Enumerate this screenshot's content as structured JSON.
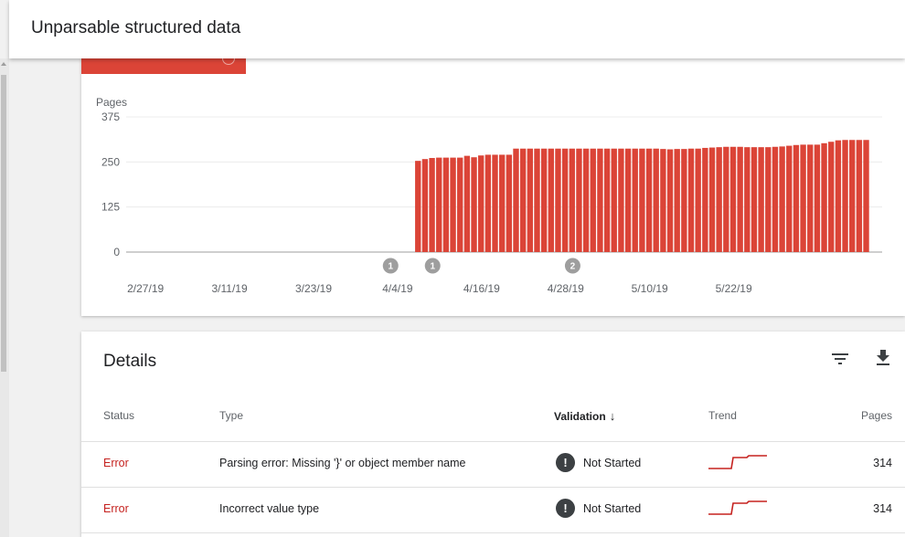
{
  "header": {
    "title": "Unparsable structured data"
  },
  "chart_data": {
    "type": "bar",
    "ylabel": "Pages",
    "ylim": [
      0,
      375
    ],
    "yticks": [
      "375",
      "250",
      "125",
      "0"
    ],
    "ytick_values": [
      375,
      250,
      125,
      0
    ],
    "xticks": [
      "2/27/19",
      "3/11/19",
      "3/23/19",
      "4/4/19",
      "4/16/19",
      "4/28/19",
      "5/10/19",
      "5/22/19"
    ],
    "values": [
      0,
      0,
      0,
      0,
      0,
      0,
      0,
      0,
      0,
      0,
      0,
      0,
      0,
      0,
      0,
      0,
      0,
      0,
      0,
      0,
      0,
      0,
      0,
      0,
      0,
      0,
      0,
      0,
      0,
      0,
      0,
      0,
      0,
      0,
      0,
      0,
      0,
      0,
      0,
      0,
      0,
      253,
      258,
      261,
      262,
      262,
      262,
      262,
      267,
      263,
      268,
      270,
      270,
      270,
      270,
      287,
      287,
      287,
      287,
      287,
      287,
      287,
      287,
      287,
      287,
      287,
      287,
      287,
      287,
      287,
      287,
      287,
      287,
      287,
      287,
      287,
      286,
      285,
      286,
      286,
      287,
      287,
      289,
      290,
      291,
      292,
      292,
      292,
      291,
      291,
      291,
      291,
      292,
      293,
      295,
      297,
      298,
      298,
      298,
      302,
      306,
      310,
      311,
      311,
      311,
      311
    ],
    "annotations": [
      {
        "label": "1",
        "date": "4/3/19"
      },
      {
        "label": "1",
        "date": "4/9/19"
      },
      {
        "label": "2",
        "date": "4/29/19"
      }
    ]
  },
  "details": {
    "title": "Details",
    "icons": {
      "filter": "filter-icon",
      "download": "download-icon"
    },
    "columns": {
      "status": "Status",
      "type": "Type",
      "validation": "Validation",
      "sort_arrow": "↓",
      "trend": "Trend",
      "pages": "Pages"
    },
    "rows": [
      {
        "status": "Error",
        "type": "Parsing error: Missing '}' or object member name",
        "validation_icon": "!",
        "validation": "Not Started",
        "pages": "314"
      },
      {
        "status": "Error",
        "type": "Incorrect value type",
        "validation_icon": "!",
        "validation": "Not Started",
        "pages": "314"
      }
    ]
  },
  "colors": {
    "error": "#db4437",
    "bar": "#db4437",
    "status_text": "#c5221f",
    "annotation": "#9e9e9e"
  }
}
